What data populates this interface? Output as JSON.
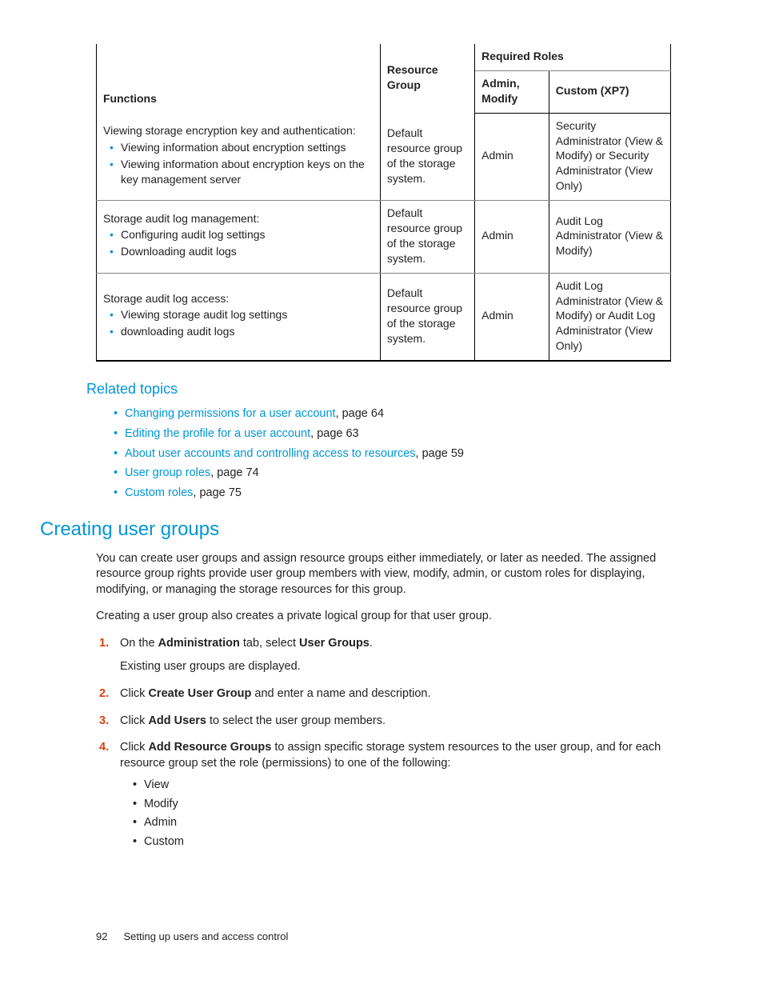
{
  "table": {
    "headers": {
      "functions": "Functions",
      "resource_group": "Resource Group",
      "required_roles": "Required Roles",
      "admin_modify": "Admin, Modify",
      "custom": "Custom (XP7)"
    },
    "rows": [
      {
        "title": "Viewing storage encryption key and authentication:",
        "bullets": [
          "Viewing information about encryption settings",
          "Viewing information about encryption keys on the key management server"
        ],
        "resource": "Default resource group of the storage system.",
        "admin": "Admin",
        "custom": "Security Administrator (View & Modify) or Security Administrator (View Only)"
      },
      {
        "title": "Storage audit log management:",
        "bullets": [
          "Configuring audit log settings",
          "Downloading audit logs"
        ],
        "resource": "Default resource group of the storage system.",
        "admin": "Admin",
        "custom": "Audit Log Administrator (View & Modify)"
      },
      {
        "title": "Storage audit log access:",
        "bullets": [
          "Viewing storage audit log settings",
          "downloading audit logs"
        ],
        "resource": "Default resource group of the storage system.",
        "admin": "Admin",
        "custom": "Audit Log Administrator (View & Modify) or Audit Log Administrator (View Only)"
      }
    ]
  },
  "related": {
    "heading": "Related topics",
    "items": [
      {
        "link": "Changing permissions for a user account",
        "suffix": ", page 64"
      },
      {
        "link": "Editing the profile for a user account",
        "suffix": ", page 63"
      },
      {
        "link": "About user accounts and controlling access to resources",
        "suffix": ", page 59"
      },
      {
        "link": "User group roles",
        "suffix": ", page 74"
      },
      {
        "link": "Custom roles",
        "suffix": ", page 75"
      }
    ]
  },
  "section": {
    "heading": "Creating user groups",
    "para1": "You can create user groups and assign resource groups either immediately, or later as needed. The assigned resource group rights provide user group members with view, modify, admin, or custom roles for displaying, modifying, or managing the storage resources for this group.",
    "para2": "Creating a user group also creates a private logical group for that user group.",
    "steps": {
      "s1": {
        "pre": "On the ",
        "b1": "Administration",
        "mid": " tab, select ",
        "b2": "User Groups",
        "post": ".",
        "after": "Existing user groups are displayed."
      },
      "s2": {
        "pre": "Click ",
        "b1": "Create User Group",
        "post": " and enter a name and description."
      },
      "s3": {
        "pre": "Click ",
        "b1": "Add Users",
        "post": " to select the user group members."
      },
      "s4": {
        "pre": "Click ",
        "b1": "Add Resource Groups",
        "post": " to assign specific storage system resources to the user group, and for each resource group set the role (permissions) to one of the following:",
        "subs": [
          "View",
          "Modify",
          "Admin",
          "Custom"
        ]
      }
    }
  },
  "footer": {
    "page": "92",
    "title": "Setting up users and access control"
  }
}
